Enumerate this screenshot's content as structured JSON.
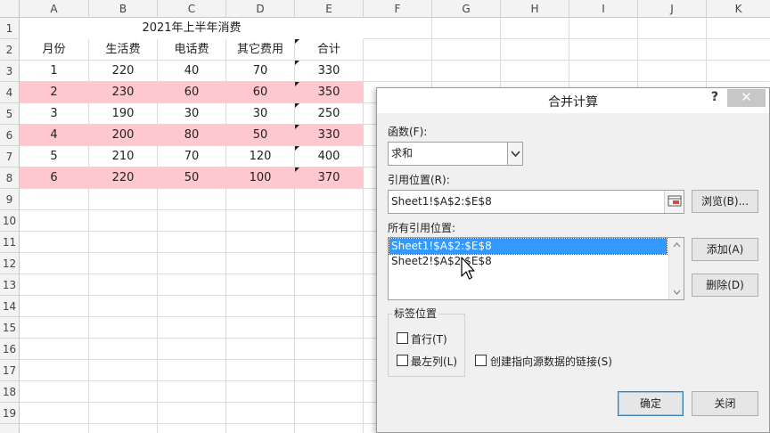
{
  "sheet": {
    "columns": [
      "A",
      "B",
      "C",
      "D",
      "E",
      "F",
      "G",
      "H",
      "I",
      "J",
      "K"
    ],
    "row_numbers": [
      "1",
      "2",
      "3",
      "4",
      "5",
      "6",
      "7",
      "8",
      "9",
      "10",
      "11",
      "12",
      "13",
      "14",
      "15",
      "16",
      "17",
      "18",
      "19"
    ],
    "title": "2021年上半年消费",
    "headers": [
      "月份",
      "生活费",
      "电话费",
      "其它费用",
      "合计"
    ],
    "rows": [
      [
        "1",
        "220",
        "40",
        "70",
        "330"
      ],
      [
        "2",
        "230",
        "60",
        "60",
        "350"
      ],
      [
        "3",
        "190",
        "30",
        "30",
        "250"
      ],
      [
        "4",
        "200",
        "80",
        "50",
        "330"
      ],
      [
        "5",
        "210",
        "70",
        "120",
        "400"
      ],
      [
        "6",
        "220",
        "50",
        "100",
        "370"
      ]
    ],
    "highlight_color": "#ffc7ce"
  },
  "dialog": {
    "title": "合并计算",
    "help": "?",
    "close": "✕",
    "function_label": "函数(F):",
    "function_value": "求和",
    "reference_label": "引用位置(R):",
    "reference_value": "Sheet1!$A$2:$E$8",
    "browse_button": "浏览(B)...",
    "all_refs_label": "所有引用位置:",
    "all_refs": [
      "Sheet1!$A$2:$E$8",
      "Sheet2!$A$2:$E$8"
    ],
    "add_button": "添加(A)",
    "delete_button": "删除(D)",
    "labels_group": "标签位置",
    "first_row": "首行(T)",
    "left_column": "最左列(L)",
    "create_links": "创建指向源数据的链接(S)",
    "ok_button": "确定",
    "close_button": "关闭"
  }
}
